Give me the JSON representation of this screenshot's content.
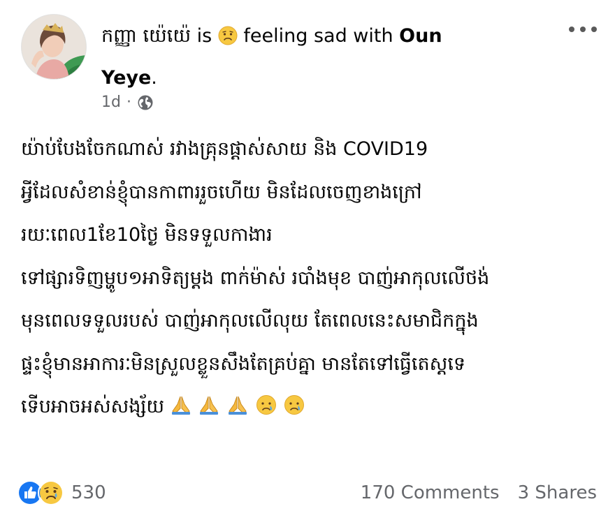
{
  "post": {
    "author": "កញ្ញា យ៉េយ៉េ",
    "is_text": "is",
    "feeling_icon": "sad-face-icon",
    "feeling_text": "feeling sad with",
    "tagged_user": "Oun Yeye",
    "tagged_user_first": "Oun",
    "tagged_user_last": "Yeye",
    "period": ".",
    "time": "1d",
    "privacy_icon": "globe-icon",
    "body_lines": [
      "យ៉ាប់បែងចែកណាស់ រវាងគ្រុនផ្តាស់សាយ និង COVID19",
      "អ្វីដែលសំខាន់ខ្ញុំបានកាពាររួចហើយ មិនដែលចេញខាងក្រៅ",
      "រយៈពេល1ខែ10ថ្ងៃ មិនទទួលកាងារ",
      "ទៅផ្សារទិញម្ហូប១អាទិត្យម្តង ពាក់ម៉ាស់ របាំងមុខ បាញ់អាកុលលើថង់",
      "មុនពេលទទួលរបស់ បាញ់អាកុលលើលុយ តែពេលនេះសមាជិកក្នុង",
      "ផ្ទះខ្ញុំមានអាការៈមិនស្រួលខ្លួនសឹងតែគ្រប់គ្នា មានតែទៅធ្វើតេស្តទេ",
      "ទើបអាចអស់សង្ស័យ"
    ],
    "body_emojis": [
      "folded-hands-icon",
      "folded-hands-icon",
      "folded-hands-icon",
      "crying-face-icon",
      "crying-face-icon"
    ]
  },
  "footer": {
    "reaction_icons": [
      "like-icon",
      "sad-reaction-icon"
    ],
    "reaction_count": "530",
    "comments": "170 Comments",
    "shares": "3 Shares"
  },
  "colors": {
    "text": "#050505",
    "secondary": "#65676b",
    "like_blue": "#1877f2",
    "sad_yellow": "#f7c841"
  }
}
